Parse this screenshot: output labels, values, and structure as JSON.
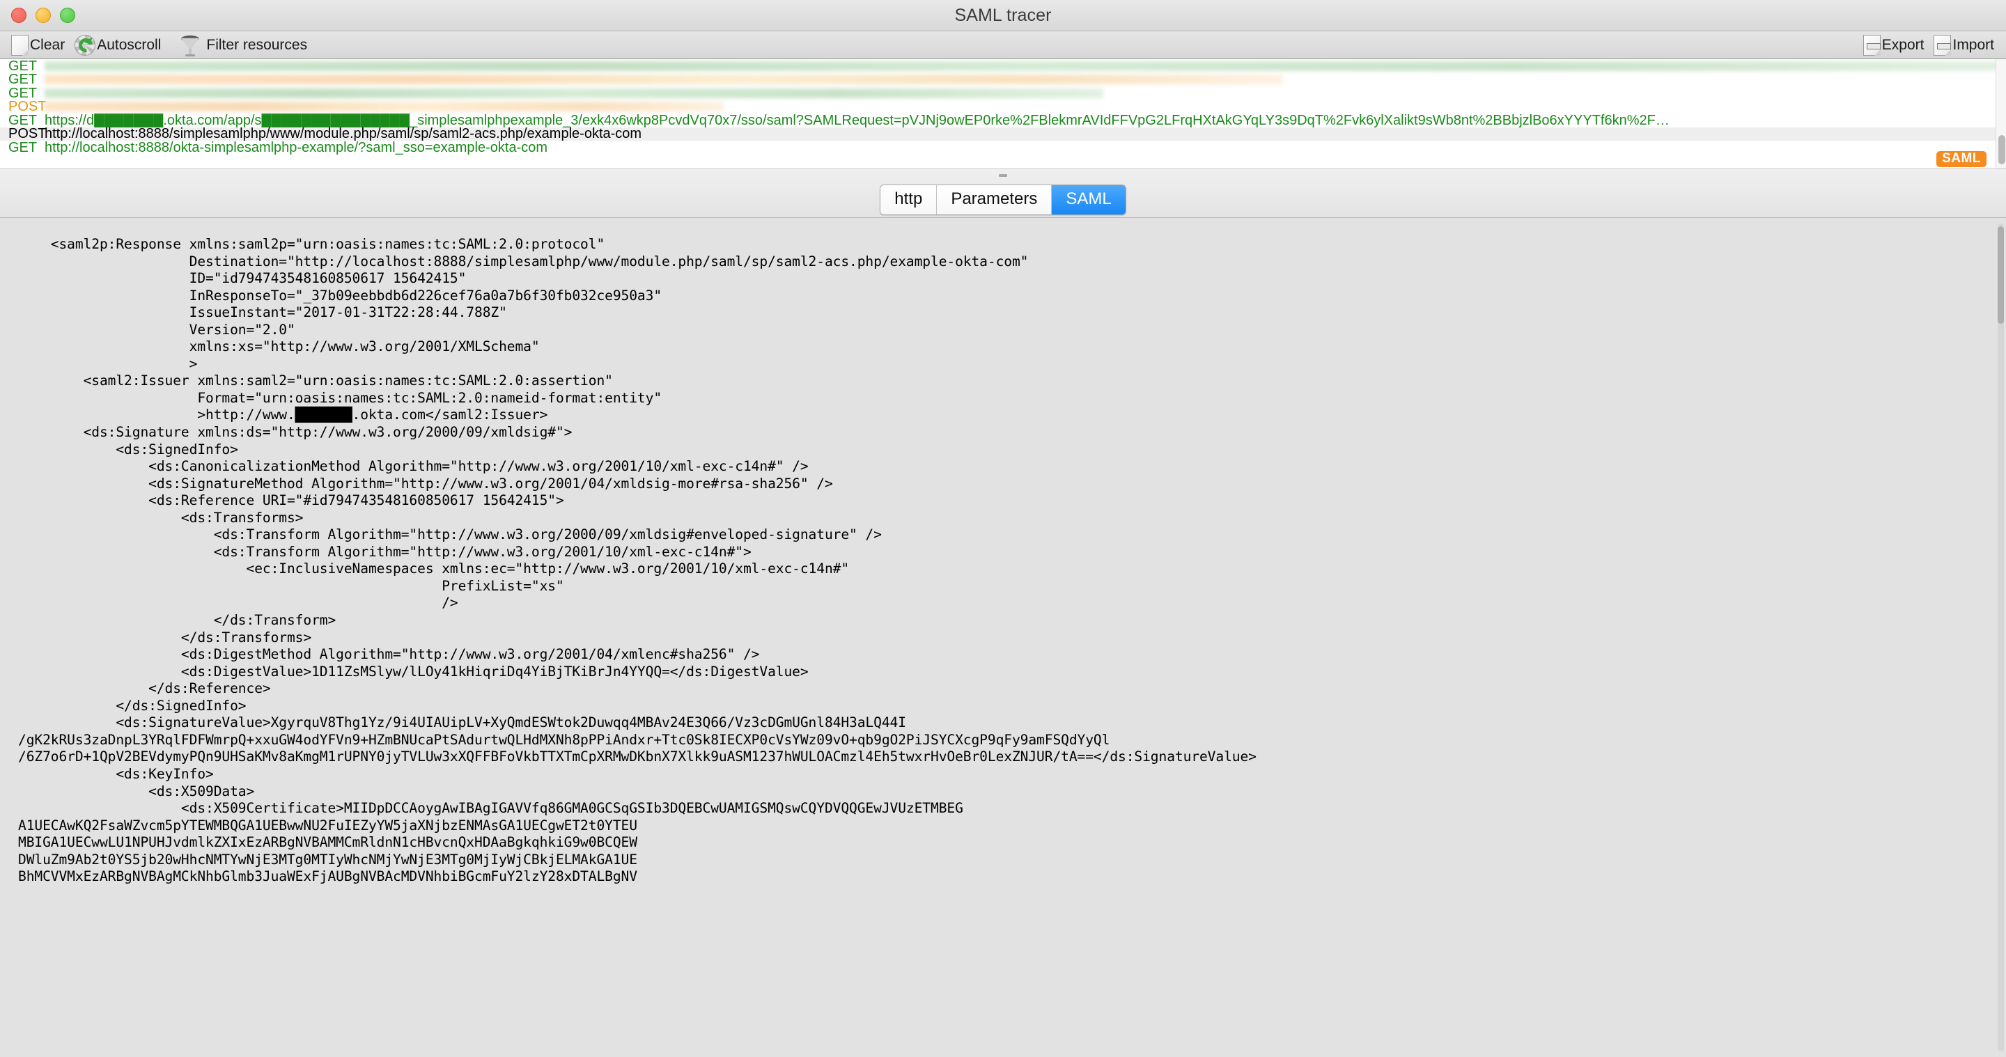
{
  "window": {
    "title": "SAML tracer",
    "traffic_lights": [
      "close",
      "minimize",
      "maximize"
    ]
  },
  "toolbar": {
    "clear_label": "Clear",
    "autoscroll_label": "Autoscroll",
    "filter_label": "Filter resources",
    "export_label": "Export",
    "import_label": "Import"
  },
  "requests": {
    "rows": [
      {
        "method": "GET",
        "url": "",
        "redacted": true,
        "blur": "green",
        "blur_width": "99%",
        "selected": false,
        "saml": false
      },
      {
        "method": "GET",
        "url": "",
        "redacted": true,
        "blur": "orange",
        "blur_width": "62%",
        "selected": false,
        "saml": false
      },
      {
        "method": "GET",
        "url": "",
        "redacted": true,
        "blur": "green",
        "blur_width": "53%",
        "selected": false,
        "saml": false
      },
      {
        "method": "POST",
        "url": "",
        "redacted": true,
        "blur": "orange",
        "blur_width": "34%",
        "selected": false,
        "saml": false
      },
      {
        "method": "GET",
        "url": "https://d███████.okta.com/app/s███████████████_simplesamlphpexample_3/exk4x6wkp8PcvdVq70x7/sso/saml?SAMLRequest=pVJNj9owEP0rke%2FBlekmrAVIdFFVpG2LFrqHXtAkGYqLY3s9DqT%2Fvk6ylXalikt9sWb8nt%2BBbjzlBo6xYYYTf6kn%2F…",
        "redacted": false,
        "selected": false,
        "saml": true
      },
      {
        "method": "POST",
        "url": "http://localhost:8888/simplesamlphp/www/module.php/saml/sp/saml2-acs.php/example-okta-com",
        "redacted": false,
        "selected": true,
        "saml": true
      },
      {
        "method": "GET",
        "url": "http://localhost:8888/okta-simplesamlphp-example/?saml_sso=example-okta-com",
        "redacted": false,
        "selected": false,
        "saml": false
      }
    ],
    "saml_badge_label": "SAML"
  },
  "detail_tabs": {
    "items": [
      {
        "label": "http",
        "active": false
      },
      {
        "label": "Parameters",
        "active": false
      },
      {
        "label": "SAML",
        "active": true
      }
    ]
  },
  "saml_xml": {
    "lines": [
      "    <saml2p:Response xmlns:saml2p=\"urn:oasis:names:tc:SAML:2.0:protocol\"",
      "                     Destination=\"http://localhost:8888/simplesamlphp/www/module.php/saml/sp/saml2-acs.php/example-okta-com\"",
      "                     ID=\"id794743548160850617 15642415\"",
      "                     InResponseTo=\"_37b09eebbdb6d226cef76a0a7b6f30fb032ce950a3\"",
      "                     IssueInstant=\"2017-01-31T22:28:44.788Z\"",
      "                     Version=\"2.0\"",
      "                     xmlns:xs=\"http://www.w3.org/2001/XMLSchema\"",
      "                     >",
      "        <saml2:Issuer xmlns:saml2=\"urn:oasis:names:tc:SAML:2.0:assertion\"",
      "                      Format=\"urn:oasis:names:tc:SAML:2.0:nameid-format:entity\"",
      "                      >http://www.███████.okta.com</saml2:Issuer>",
      "        <ds:Signature xmlns:ds=\"http://www.w3.org/2000/09/xmldsig#\">",
      "            <ds:SignedInfo>",
      "                <ds:CanonicalizationMethod Algorithm=\"http://www.w3.org/2001/10/xml-exc-c14n#\" />",
      "                <ds:SignatureMethod Algorithm=\"http://www.w3.org/2001/04/xmldsig-more#rsa-sha256\" />",
      "                <ds:Reference URI=\"#id794743548160850617 15642415\">",
      "                    <ds:Transforms>",
      "                        <ds:Transform Algorithm=\"http://www.w3.org/2000/09/xmldsig#enveloped-signature\" />",
      "                        <ds:Transform Algorithm=\"http://www.w3.org/2001/10/xml-exc-c14n#\">",
      "                            <ec:InclusiveNamespaces xmlns:ec=\"http://www.w3.org/2001/10/xml-exc-c14n#\"",
      "                                                    PrefixList=\"xs\"",
      "                                                    />",
      "                        </ds:Transform>",
      "                    </ds:Transforms>",
      "                    <ds:DigestMethod Algorithm=\"http://www.w3.org/2001/04/xmlenc#sha256\" />",
      "                    <ds:DigestValue>1D11ZsMSlyw/lLOy41kHiqriDq4YiBjTKiBrJn4YYQQ=</ds:DigestValue>",
      "                </ds:Reference>",
      "            </ds:SignedInfo>",
      "            <ds:SignatureValue>XgyrquV8Thg1Yz/9i4UIAUipLV+XyQmdESWtok2Duwqq4MBAv24E3Q66/Vz3cDGmUGnl84H3aLQ44I",
      "/gK2kRUs3zaDnpL3YRqlFDFWmrpQ+xxuGW4odYFVn9+HZmBNUcaPtSAdurtwQLHdMXNh8pPPiAndxr+Ttc0Sk8IECXP0cVsYWz09vO+qb9gO2PiJSYCXcgP9qFy9amFSQdYyQl",
      "/6Z7o6rD+1QpV2BEVdymyPQn9UHSaKMv8aKmgM1rUPNY0jyTVLUw3xXQFFBFoVkbTTXTmCpXRMwDKbnX7Xlkk9uASM1237hWULOACmzl4Eh5twxrHvOeBr0LexZNJUR/tA==</ds:SignatureValue>",
      "            <ds:KeyInfo>",
      "                <ds:X509Data>",
      "                    <ds:X509Certificate>MIIDpDCCAoygAwIBAgIGAVVfq86GMA0GCSqGSIb3DQEBCwUAMIGSMQswCQYDVQQGEwJVUzETMBEG",
      "A1UECAwKQ2FsaWZvcm5pYTEWMBQGA1UEBwwNU2FuIEZyYW5jaXNjbzENMAsGA1UECgwET2t0YTEU",
      "MBIGA1UECwwLU1NPUHJvdmlkZXIxEzARBgNVBAMMCmRldnN1cHBvcnQxHDAaBgkqhkiG9w0BCQEW",
      "DWluZm9Ab2t0YS5jb20wHhcNMTYwNjE3MTg0MTIyWhcNMjYwNjE3MTg0MjIyWjCBkjELMAkGA1UE",
      "BhMCVVMxEzARBgNVBAgMCkNhbGlmb3JuaWExFjAUBgNVBAcMDVNhbiBGcmFuY2lzY28xDTALBgNV"
    ]
  },
  "colors": {
    "get_method": "#1a8a1a",
    "post_method": "#e8920f",
    "saml_badge": "#f68b1f",
    "active_tab": "#1787f5",
    "xml_background": "#e2e2e2"
  }
}
